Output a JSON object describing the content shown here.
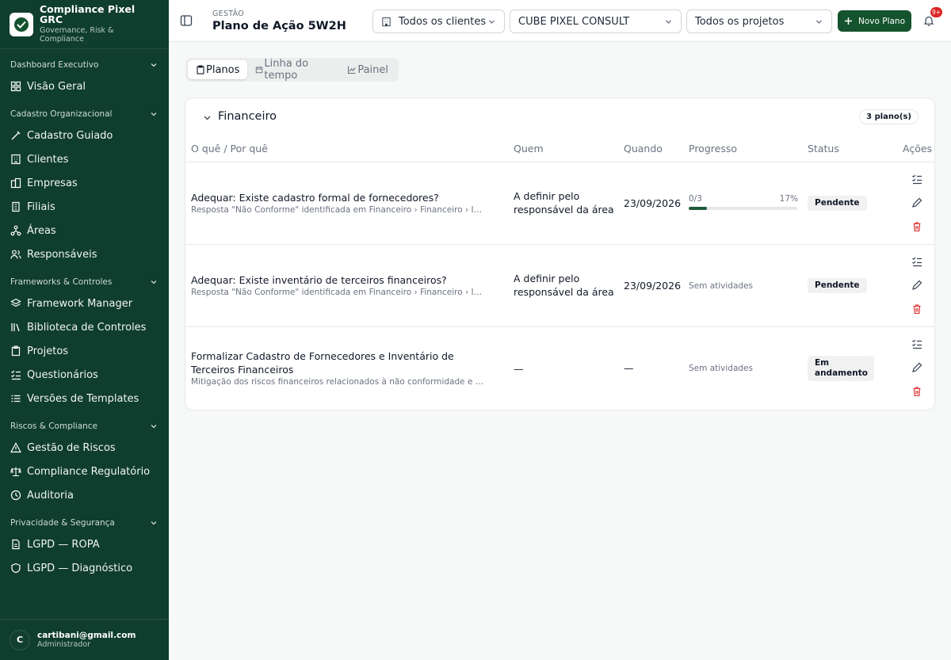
{
  "brand": {
    "title": "Compliance Pixel GRC",
    "subtitle": "Governance, Risk & Compliance"
  },
  "sidebar": {
    "sections": [
      {
        "label": "Dashboard Executivo",
        "items": [
          {
            "label": "Visão Geral",
            "icon": "grid-icon"
          }
        ]
      },
      {
        "label": "Cadastro Organizacional",
        "items": [
          {
            "label": "Cadastro Guiado",
            "icon": "magic-icon"
          },
          {
            "label": "Clientes",
            "icon": "building-icon"
          },
          {
            "label": "Empresas",
            "icon": "building2-icon"
          },
          {
            "label": "Filiais",
            "icon": "building-small-icon"
          },
          {
            "label": "Áreas",
            "icon": "network-icon"
          },
          {
            "label": "Responsáveis",
            "icon": "users-icon"
          }
        ]
      },
      {
        "label": "Frameworks & Controles",
        "items": [
          {
            "label": "Framework Manager",
            "icon": "layers-icon"
          },
          {
            "label": "Biblioteca de Controles",
            "icon": "library-icon"
          },
          {
            "label": "Projetos",
            "icon": "clipboard-icon"
          },
          {
            "label": "Questionários",
            "icon": "list-checks-icon"
          },
          {
            "label": "Versões de Templates",
            "icon": "git-branch-icon"
          }
        ]
      },
      {
        "label": "Riscos & Compliance",
        "items": [
          {
            "label": "Gestão de Riscos",
            "icon": "alert-icon"
          },
          {
            "label": "Compliance Regulatório",
            "icon": "scale-icon"
          },
          {
            "label": "Auditoria",
            "icon": "clock-icon"
          }
        ]
      },
      {
        "label": "Privacidade & Segurança",
        "items": [
          {
            "label": "LGPD — ROPA",
            "icon": "file-icon"
          },
          {
            "label": "LGPD — Diagnóstico",
            "icon": "shield-icon"
          }
        ]
      }
    ]
  },
  "user": {
    "initial": "C",
    "email": "cartibani@gmail.com",
    "role": "Administrador"
  },
  "header": {
    "breadcrumb": "GESTÃO",
    "title": "Plano de Ação 5W2H",
    "client_select": "Todos os clientes",
    "company_select": "CUBE PIXEL CONSULT",
    "project_select": "Todos os projetos",
    "new_plan_label": "Novo Plano",
    "notif_count": "9+"
  },
  "tabs": [
    {
      "label": "Planos",
      "active": true
    },
    {
      "label": "Linha do tempo",
      "active": false
    },
    {
      "label": "Painel",
      "active": false
    }
  ],
  "group": {
    "title": "Financeiro",
    "count": "3 plano(s)",
    "columns": [
      "O quê / Por quê",
      "Quem",
      "Quando",
      "Progresso",
      "Status",
      "Ações"
    ],
    "rows": [
      {
        "what": "Adequar: Existe cadastro formal de fornecedores?",
        "why": "Resposta \"Não Conforme\" identificada em Financeiro › Financeiro › Inventário de Terceiros",
        "who": "A definir pelo responsável da área",
        "when": "23/09/2026",
        "progress_label": "0/3",
        "progress_pct_label": "17%",
        "progress_pct": 17,
        "status": "Pendente"
      },
      {
        "what": "Adequar: Existe inventário de terceiros financeiros?",
        "why": "Resposta \"Não Conforme\" identificada em Financeiro › Financeiro › Inventário de Terceiros",
        "who": "A definir pelo responsável da área",
        "when": "23/09/2026",
        "progress_label": "Sem atividades",
        "status": "Pendente"
      },
      {
        "what": "Formalizar Cadastro de Fornecedores e Inventário de Terceiros Financeiros",
        "why": "Mitigação dos riscos financeiros relacionados à não conformidade e transparência",
        "who": "—",
        "when": "—",
        "progress_label": "Sem atividades",
        "status": "Em andamento"
      }
    ]
  },
  "colors": {
    "sidebar_bg": "#0f3d2e",
    "primary": "#14532d",
    "danger": "#dc2626"
  }
}
